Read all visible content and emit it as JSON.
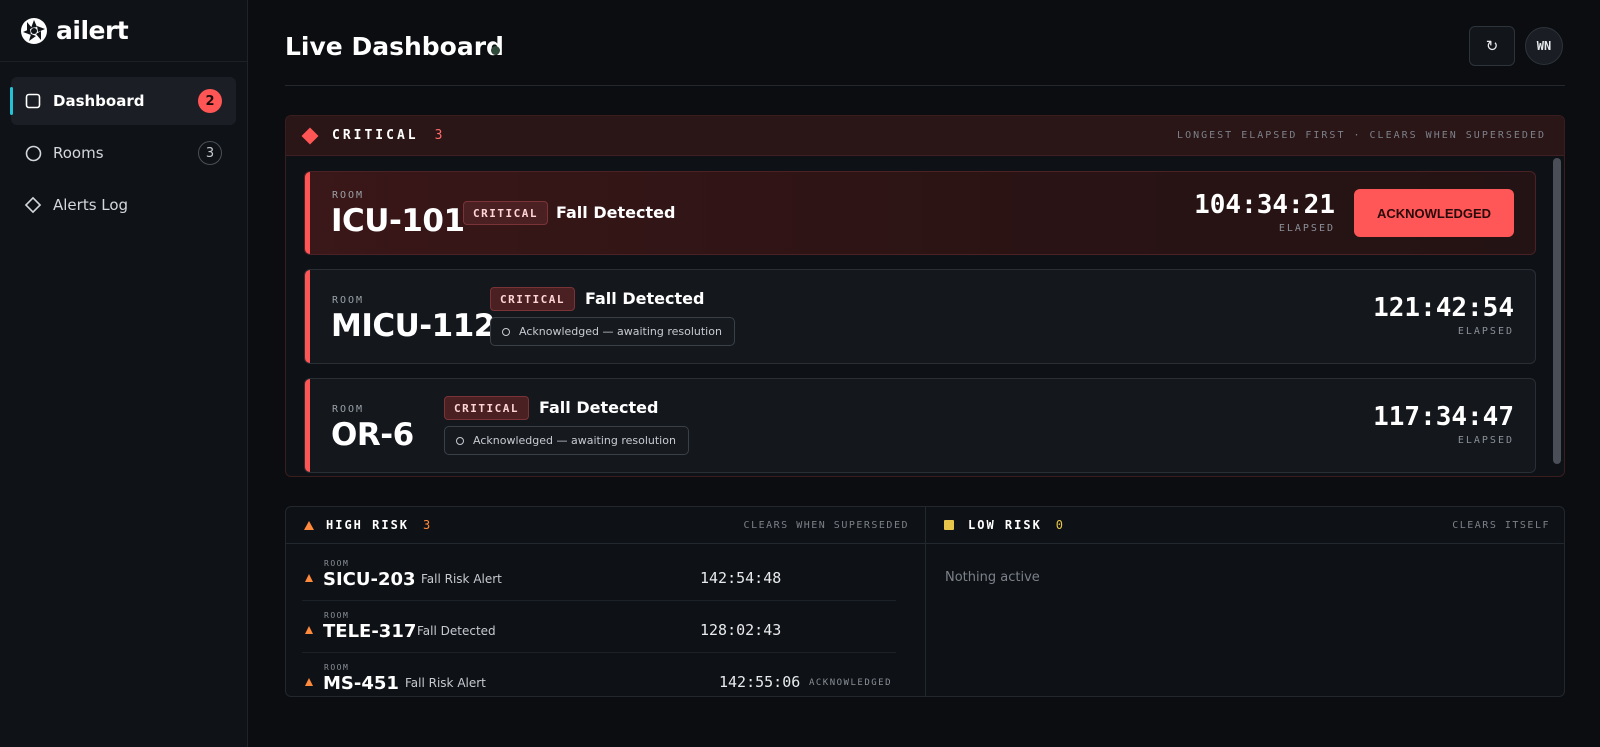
{
  "brand": {
    "name": "ailert",
    "logo_icon": "aperture-icon"
  },
  "sidebar": {
    "items": [
      {
        "label": "Dashboard",
        "icon": "square-icon",
        "badge": "2",
        "active": true
      },
      {
        "label": "Rooms",
        "icon": "circle-icon",
        "badge": "3"
      },
      {
        "label": "Alerts Log",
        "icon": "diamond-icon"
      }
    ]
  },
  "header": {
    "title": "Live Dashboard",
    "refresh_glyph": "↻",
    "avatar_initials": "WN"
  },
  "critical": {
    "title": "CRITICAL",
    "count": "3",
    "hint": "LONGEST ELAPSED FIRST · CLEARS WHEN SUPERSEDED",
    "room_label": "ROOM",
    "elapsed_label": "ELAPSED",
    "alerts": [
      {
        "room": "ICU-101",
        "severity": "CRITICAL",
        "event": "Fall Detected",
        "elapsed": "104:34:21",
        "action": "ACKNOWLEDGED"
      },
      {
        "room": "MICU-112",
        "severity": "CRITICAL",
        "event": "Fall Detected",
        "status": "Acknowledged — awaiting resolution",
        "elapsed": "121:42:54"
      },
      {
        "room": "OR-6",
        "severity": "CRITICAL",
        "event": "Fall Detected",
        "status": "Acknowledged — awaiting resolution",
        "elapsed": "117:34:47"
      }
    ]
  },
  "high_risk": {
    "title": "HIGH RISK",
    "count": "3",
    "hint": "CLEARS WHEN SUPERSEDED",
    "room_label": "ROOM",
    "rows": [
      {
        "room": "SICU-203",
        "event": "Fall Risk Alert",
        "elapsed": "142:54:48"
      },
      {
        "room": "TELE-317",
        "event": "Fall Detected",
        "elapsed": "128:02:43"
      },
      {
        "room": "MS-451",
        "event": "Fall Risk Alert",
        "elapsed": "142:55:06",
        "status": "ACKNOWLEDGED"
      }
    ]
  },
  "low_risk": {
    "title": "LOW RISK",
    "count": "0",
    "hint": "CLEARS ITSELF",
    "empty": "Nothing active"
  },
  "colors": {
    "critical": "#ff5555",
    "high": "#ff8a3d",
    "low": "#e7c54a",
    "accent": "#22c3d6"
  }
}
